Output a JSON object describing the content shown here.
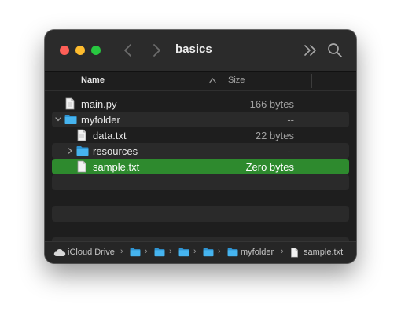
{
  "window": {
    "title": "basics",
    "traffic_lights": {
      "close": "#ff5f57",
      "minimize": "#febc2e",
      "maximize": "#28c840"
    }
  },
  "toolbar": {
    "back_icon": "chevron-left-icon",
    "forward_icon": "chevron-right-icon",
    "more_icon": "double-chevron-right-icon",
    "search_icon": "magnifying-glass-icon"
  },
  "columns": {
    "name": "Name",
    "size": "Size",
    "sort": "ascending"
  },
  "files": [
    {
      "name": "main.py",
      "size": "166 bytes",
      "kind": "file",
      "indent": 0
    },
    {
      "name": "myfolder",
      "size": "--",
      "kind": "folder",
      "indent": 0,
      "expanded": true
    },
    {
      "name": "data.txt",
      "size": "22 bytes",
      "kind": "file",
      "indent": 1
    },
    {
      "name": "resources",
      "size": "--",
      "kind": "folder",
      "indent": 1,
      "expanded": false
    },
    {
      "name": "sample.txt",
      "size": "Zero bytes",
      "kind": "file",
      "indent": 1,
      "selected": true
    }
  ],
  "colors": {
    "selection": "#2e8a2e",
    "folder": "#3ea8e5",
    "window_bg": "#1e1e1e"
  },
  "pathbar": [
    {
      "label": "iCloud Drive",
      "icon": "cloud-icon"
    },
    {
      "label": "",
      "icon": "folder-icon"
    },
    {
      "label": "",
      "icon": "folder-icon"
    },
    {
      "label": "",
      "icon": "folder-icon"
    },
    {
      "label": "",
      "icon": "folder-icon"
    },
    {
      "label": "myfolder",
      "icon": "folder-icon"
    },
    {
      "label": "sample.txt",
      "icon": "file-icon"
    }
  ]
}
